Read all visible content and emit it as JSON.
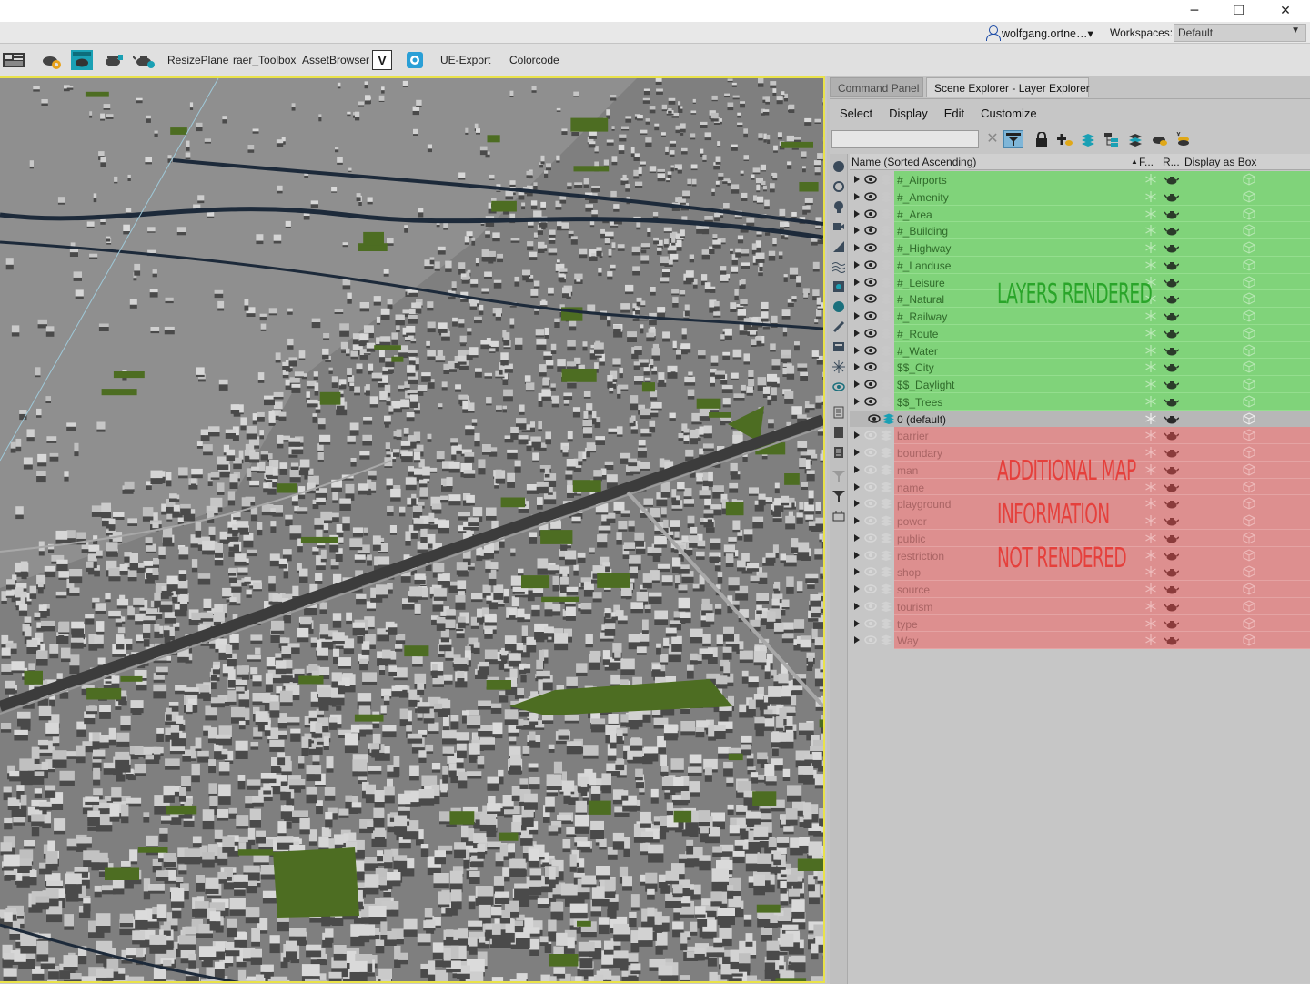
{
  "window": {
    "minimize": "─",
    "restore": "❐",
    "close": "✕"
  },
  "account": {
    "user": "wolfgang.ortne…▾",
    "workspaces_label": "Workspaces:",
    "workspace_value": "Default"
  },
  "toolbar": {
    "icons": [
      "scene-layout-icon",
      "gear-teapot-icon",
      "render-frame-icon",
      "teapot-render-icon",
      "teapot-icon"
    ],
    "buttons": [
      "ResizePlane",
      "raer_Toolbox",
      "AssetBrowser",
      "UE-Export",
      "Colorcode"
    ],
    "v_logo": "V"
  },
  "panel": {
    "tabs": [
      "Command Panel",
      "Scene Explorer - Layer Explorer"
    ],
    "menu": [
      "Select",
      "Display",
      "Edit",
      "Customize"
    ],
    "search_value": "",
    "header": {
      "name": "Name (Sorted Ascending)",
      "sort": "▲",
      "freeze": "F...",
      "render": "R...",
      "box": "Display as Box"
    },
    "rendered_layers": [
      "#_Airports",
      "#_Amenity",
      "#_Area",
      "#_Building",
      "#_Highway",
      "#_Landuse",
      "#_Leisure",
      "#_Natural",
      "#_Railway",
      "#_Route",
      "#_Water",
      "$$_City",
      "$$_Daylight",
      "$$_Trees"
    ],
    "default_layer": "0 (default)",
    "hidden_layers": [
      "barrier",
      "boundary",
      "man",
      "name",
      "playground",
      "power",
      "public",
      "restriction",
      "shop",
      "source",
      "tourism",
      "type",
      "Way"
    ]
  },
  "annotations": {
    "rendered": "LAYERS RENDERED",
    "not_rendered": [
      "ADDITIONAL MAP",
      "INFORMATION",
      "NOT RENDERED"
    ]
  },
  "colors": {
    "rendered_row": "#80d37a",
    "hidden_row": "#dd8f8f",
    "viewport_border": "#e9e24a"
  }
}
